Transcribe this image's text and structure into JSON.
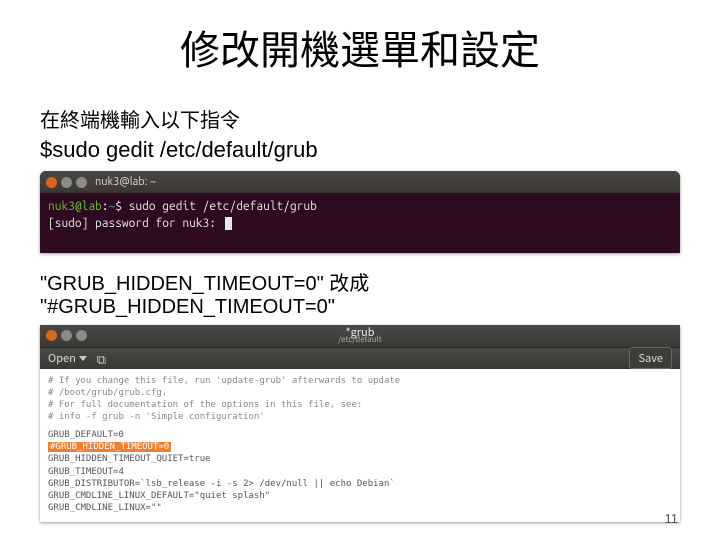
{
  "title": "修改開機選單和設定",
  "subhead": "在終端機輸入以下指令",
  "command": "$sudo gedit /etc/default/grub",
  "terminal": {
    "window_title": "nuk3@lab: ~",
    "prompt_user": "nuk3@lab",
    "prompt_path": "~",
    "prompt_symbol": "$",
    "line1_cmd": "sudo gedit /etc/default/grub",
    "line2": "[sudo] password for nuk3:"
  },
  "modify": {
    "before": "\"GRUB_HIDDEN_TIMEOUT=0\"",
    "verb": "改成",
    "after": "\"#GRUB_HIDDEN_TIMEOUT=0\""
  },
  "editor": {
    "title": "*grub",
    "subtitle": "/etc/default",
    "open_label": "Open",
    "save_label": "Save",
    "lines": {
      "c1": "# If you change this file, run 'update-grub' afterwards to update",
      "c2": "# /boot/grub/grub.cfg.",
      "c3": "# For full documentation of the options in this file, see:",
      "c4": "#   info -f grub -n 'Simple configuration'",
      "l1": "GRUB_DEFAULT=0",
      "l2": "#GRUB_HIDDEN_TIMEOUT=0",
      "l3": "GRUB_HIDDEN_TIMEOUT_QUIET=true",
      "l4": "GRUB_TIMEOUT=4",
      "l5": "GRUB_DISTRIBUTOR=`lsb_release -i -s 2> /dev/null || echo Debian`",
      "l6": "GRUB_CMDLINE_LINUX_DEFAULT=\"quiet splash\"",
      "l7": "GRUB_CMDLINE_LINUX=\"\""
    }
  },
  "page_number": "11"
}
